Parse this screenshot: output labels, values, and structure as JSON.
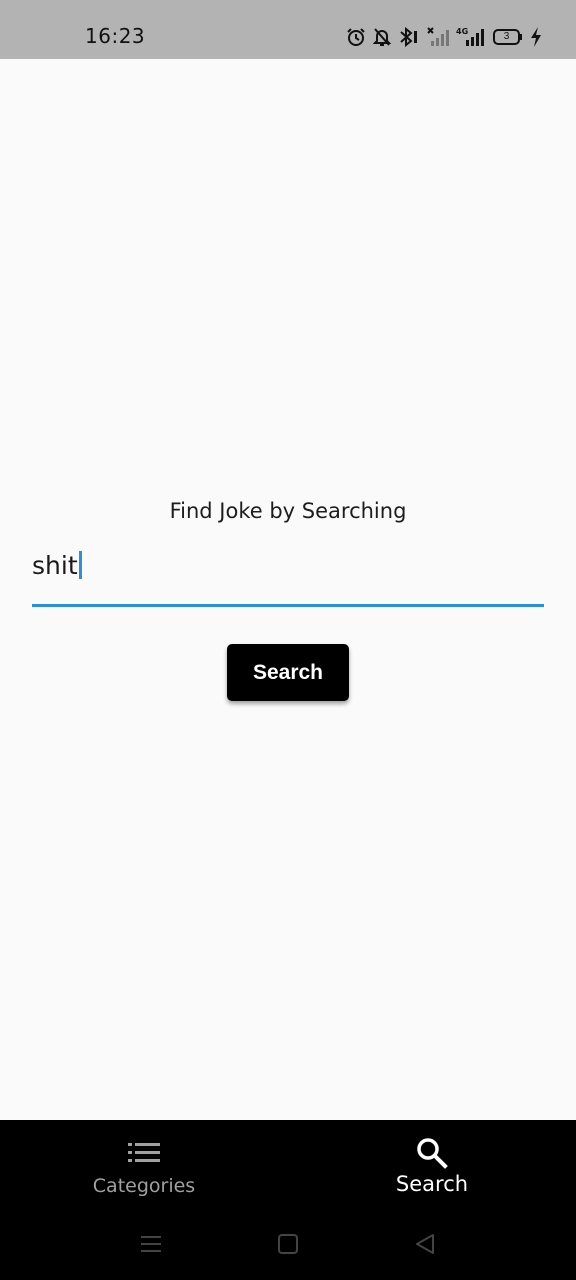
{
  "status_bar": {
    "time": "16:23",
    "battery_level": "3",
    "icons": [
      "alarm-icon",
      "notifications-off-icon",
      "bluetooth-icon",
      "signal-no-service-icon",
      "signal-4g-icon",
      "battery-icon",
      "charging-icon"
    ]
  },
  "main": {
    "prompt": "Find Joke by Searching",
    "search_value": "shit",
    "search_button_label": "Search"
  },
  "bottom_nav": {
    "items": [
      {
        "label": "Categories",
        "icon": "list-icon",
        "selected": false
      },
      {
        "label": "Search",
        "icon": "search-icon",
        "selected": true
      }
    ]
  },
  "system_nav": {
    "buttons": [
      "recents-menu-icon",
      "home-square-icon",
      "back-triangle-icon"
    ]
  },
  "colors": {
    "accent": "#2b90d9",
    "status_bar_bg": "#b3b3b3",
    "background": "#fafafa",
    "nav_bg": "#000000"
  }
}
